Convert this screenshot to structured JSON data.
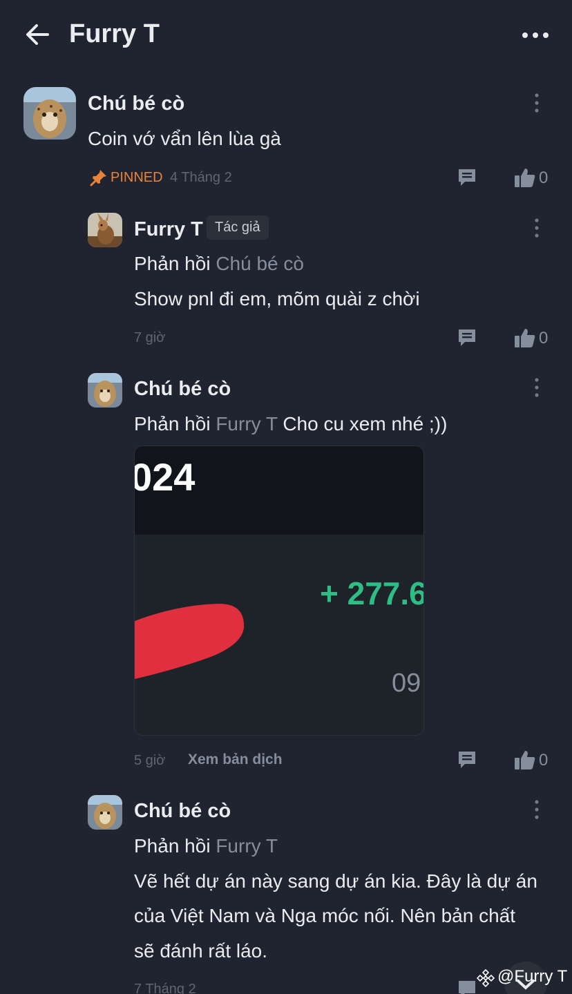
{
  "header": {
    "title": "Furry T",
    "back_icon": "arrow-left-icon",
    "more_icon": "more-horizontal-icon"
  },
  "comment_main": {
    "author": "Chú bé cò",
    "text": "Coin vớ vẩn lên lùa gà",
    "pinned_label": "PINNED",
    "date": "4 Tháng 2",
    "likes": "0"
  },
  "reply1": {
    "author": "Furry T",
    "badge": "Tác giả",
    "reply_prefix": "Phản hồi",
    "reply_to": "Chú bé cò",
    "text": "Show pnl đi em, mõm quài z chời",
    "time": "7 giờ",
    "likes": "0"
  },
  "reply2": {
    "author": "Chú bé cò",
    "reply_prefix": "Phản hồi",
    "reply_to": "Furry T",
    "text": "Cho cu xem nhé ;))",
    "attachment": {
      "year_text": "024",
      "pnl_text": "+ 277.6",
      "small_text": "09"
    },
    "time": "5 giờ",
    "translate_label": "Xem bản dịch",
    "likes": "0"
  },
  "reply3": {
    "author": "Chú bé cò",
    "reply_prefix": "Phản hồi",
    "reply_to": "Furry T",
    "text_lines": [
      "Vẽ hết dự án này sang dự án kia. Đây là dự án",
      "của Việt Nam và Nga móc nối. Nên bản chất",
      "sẽ đánh rất láo."
    ],
    "time": "7 Tháng 2"
  },
  "watermark": "@Furry T",
  "colors": {
    "background": "#1f2430",
    "pinned": "#e8833a",
    "pnl_green": "#2ebd85",
    "muted": "#848e9c"
  }
}
